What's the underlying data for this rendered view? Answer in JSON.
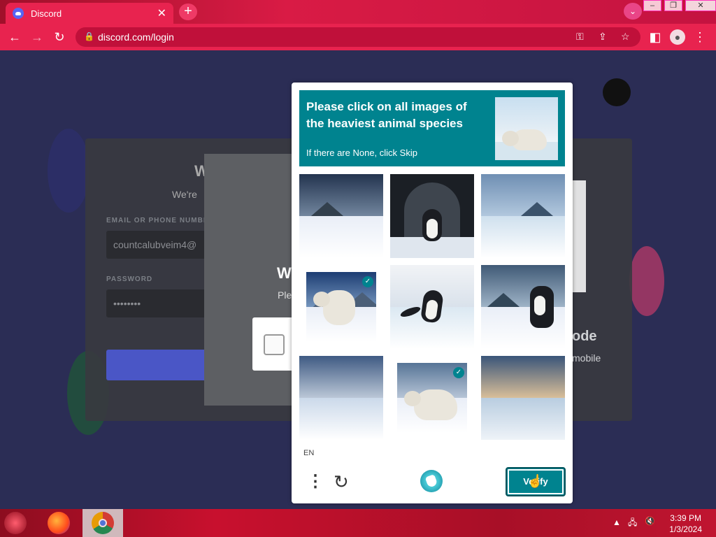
{
  "browser": {
    "tab_title": "Discord",
    "tab_close": "✕",
    "new_tab": "+",
    "url": "discord.com/login"
  },
  "page": {
    "email_label": "EMAIL OR PHONE NUMBER",
    "email_value": "countcalubveim4@",
    "password_label": "PASSWORD",
    "password_value": "••••••••",
    "heading_partial": "W",
    "sub_partial": "We're",
    "modal_heading_partial": "W",
    "modal_sub_partial": "Ple",
    "qr_heading_partial": "ode",
    "qr_sub_partial": "mobile"
  },
  "captcha": {
    "prompt_title": "Please click on all images of the heaviest animal species",
    "prompt_sub": "If there are None, click Skip",
    "language": "EN",
    "verify_label": "Verify",
    "tiles": [
      {
        "content": "snow landscape",
        "selected": false
      },
      {
        "content": "penguin in igloo",
        "selected": false
      },
      {
        "content": "icy mountains",
        "selected": false
      },
      {
        "content": "polar bear",
        "selected": true
      },
      {
        "content": "penguin on ice",
        "selected": false
      },
      {
        "content": "penguin on snow",
        "selected": false
      },
      {
        "content": "snow field",
        "selected": false
      },
      {
        "content": "polar bear",
        "selected": true
      },
      {
        "content": "snow horizon",
        "selected": false
      }
    ]
  },
  "taskbar": {
    "time": "3:39 PM",
    "date": "1/3/2024"
  },
  "colors": {
    "chrome_red": "#e8234f",
    "captcha_teal": "#00838f"
  }
}
